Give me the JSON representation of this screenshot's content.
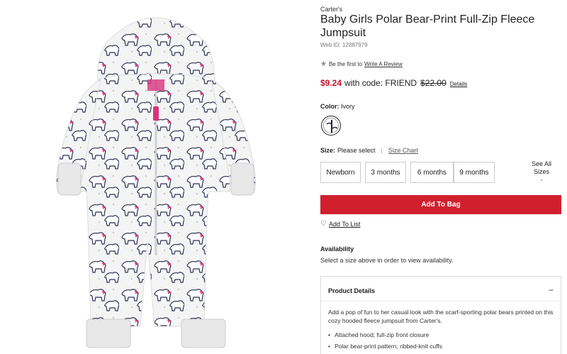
{
  "product": {
    "brand": "Carter's",
    "title": "Baby Girls Polar Bear-Print Full-Zip Fleece Jumpsuit",
    "web_id": "Web ID: 12887979",
    "image_alt": "polar-bear-print-jumpsuit"
  },
  "rating": {
    "prefix": "Be the first to",
    "link_label": "Write A Review"
  },
  "price": {
    "sale": "$9.24",
    "code_text": "with code: FRIEND",
    "original": "$22.00",
    "details_link": "Details"
  },
  "color": {
    "label": "Color:",
    "value": "Ivory"
  },
  "size": {
    "label": "Size:",
    "value": "Please select",
    "chart_link": "Size Chart",
    "options": [
      "Newborn",
      "3 months",
      "6 months",
      "9 months"
    ],
    "see_all": "See All Sizes"
  },
  "actions": {
    "add_to_bag": "Add To Bag",
    "add_to_list": "Add To List"
  },
  "availability": {
    "title": "Availability",
    "text": "Select a size above in order to view availability."
  },
  "details": {
    "title": "Product Details",
    "description": "Add a pop of fun to her casual look with the scarf-sporting polar bears printed on this cozy hooded fleece jumpsuit from Carter's.",
    "bullets": [
      "Attached hood; full-zip front closure",
      "Polar bear-print pattern; ribbed-knit cuffs"
    ]
  },
  "colors": {
    "accent_red": "#d0202e",
    "sale_red": "#c8102e",
    "print_navy": "#2b2f55",
    "print_pink": "#d8337a"
  }
}
